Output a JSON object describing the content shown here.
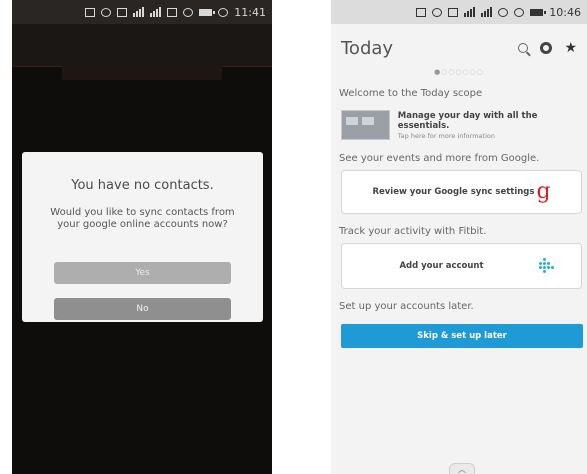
{
  "left": {
    "statusbar": {
      "time": "11:41"
    },
    "dialog": {
      "title": "You have no contacts.",
      "message": "Would you like to sync contacts from your google online accounts now?",
      "yes_label": "Yes",
      "no_label": "No"
    }
  },
  "right": {
    "statusbar": {
      "time": "10:46"
    },
    "header": {
      "title": "Today"
    },
    "welcome": {
      "label": "Welcome to the Today scope",
      "title": "Manage your day with all the essentials.",
      "subtitle": "Tap here for more information"
    },
    "google": {
      "label": "See your events and more from Google.",
      "button": "Review your Google sync settings",
      "icon_glyph": "g"
    },
    "fitbit": {
      "label": "Track your activity with Fitbit.",
      "button": "Add your account"
    },
    "later": {
      "label": "Set up your accounts later.",
      "button": "Skip & set up later"
    },
    "bottom_glyph": "︿"
  },
  "colors": {
    "accent": "#1e9ad6",
    "google_red": "#d1212a",
    "fitbit_teal": "#20b6c6"
  }
}
